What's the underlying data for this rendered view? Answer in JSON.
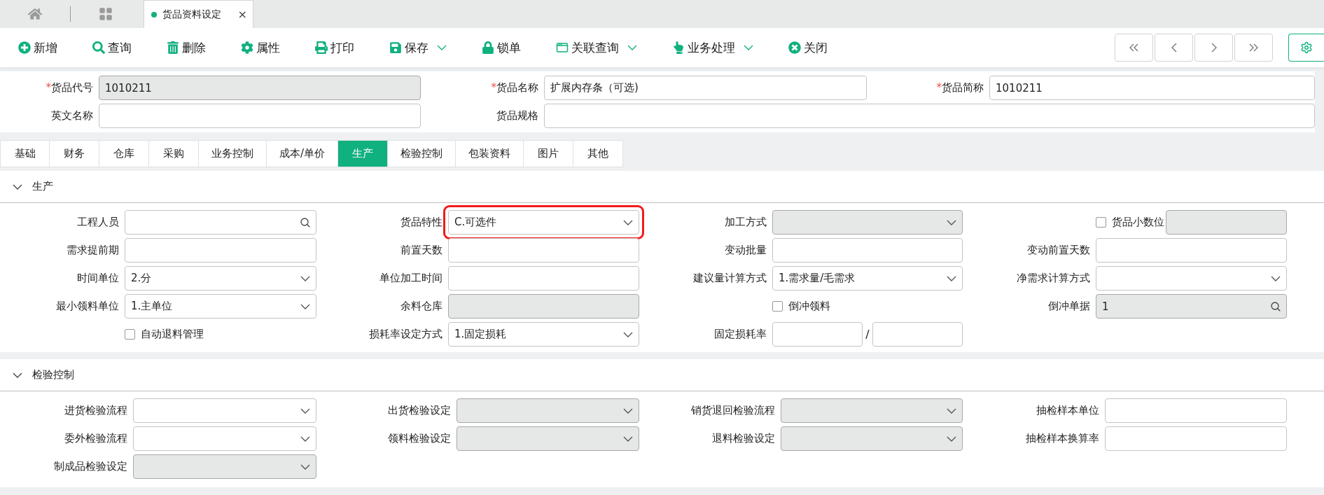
{
  "window_tabs": [
    {
      "label": "货品资料设定",
      "selected": true,
      "close": "×"
    }
  ],
  "toolbar": [
    {
      "label": "新增",
      "dropdown": false
    },
    {
      "label": "查询",
      "dropdown": false
    },
    {
      "label": "删除",
      "dropdown": false
    },
    {
      "label": "属性",
      "dropdown": false
    },
    {
      "label": "打印",
      "dropdown": false
    },
    {
      "label": "保存",
      "dropdown": true
    },
    {
      "label": "锁单",
      "dropdown": false
    },
    {
      "label": "关联查询",
      "dropdown": true
    },
    {
      "label": "业务处理",
      "dropdown": true
    },
    {
      "label": "关闭",
      "dropdown": false
    }
  ],
  "header_form": [
    [
      {
        "label": "货品代号",
        "required_mark": "*",
        "value": "1010211",
        "disabled": true
      },
      {
        "label": "货品名称",
        "required_mark": "*",
        "value": "扩展内存条（可选)",
        "disabled": false
      },
      {
        "label": "货品简称",
        "required_mark": "*",
        "value": "1010211",
        "disabled": false
      }
    ],
    [
      {
        "label": "英文名称",
        "disabled": false
      },
      {
        "label": "货品规格",
        "disabled": false,
        "wide": true
      }
    ]
  ],
  "tabs": [
    {
      "label": "基础",
      "selected": false
    },
    {
      "label": "财务",
      "selected": false
    },
    {
      "label": "仓库",
      "selected": false
    },
    {
      "label": "采购",
      "selected": false
    },
    {
      "label": "业务控制",
      "selected": false
    },
    {
      "label": "成本/单价",
      "selected": false
    },
    {
      "label": "生产",
      "selected": true
    },
    {
      "label": "检验控制",
      "selected": false
    },
    {
      "label": "包装资料",
      "selected": false
    },
    {
      "label": "图片",
      "selected": false
    },
    {
      "label": "其他",
      "selected": false
    }
  ],
  "sections": [
    {
      "title": "生产",
      "expanded": true,
      "rows": [
        [
          {
            "kind": "search",
            "label": "工程人员",
            "disabled": false
          },
          {
            "kind": "select",
            "label": "货品特性",
            "value": "C.可选件",
            "disabled": false,
            "highlighted": true
          },
          {
            "kind": "select",
            "label": "加工方式",
            "disabled": true
          },
          {
            "kind": "checkbox_input",
            "label": "货品小数位",
            "checked": false,
            "disabled": true
          }
        ],
        [
          {
            "kind": "text",
            "label": "需求提前期",
            "disabled": false
          },
          {
            "kind": "text",
            "label": "前置天数",
            "disabled": false
          },
          {
            "kind": "text",
            "label": "变动批量",
            "disabled": false
          },
          {
            "kind": "text",
            "label": "变动前置天数",
            "disabled": false
          }
        ],
        [
          {
            "kind": "select",
            "label": "时间单位",
            "value": "2.分",
            "disabled": false
          },
          {
            "kind": "text",
            "label": "单位加工时间",
            "disabled": false
          },
          {
            "kind": "select",
            "label": "建议量计算方式",
            "value": "1.需求量/毛需求",
            "disabled": false
          },
          {
            "kind": "select",
            "label": "净需求计算方式",
            "disabled": false
          }
        ],
        [
          {
            "kind": "select",
            "label": "最小领料单位",
            "value": "1.主单位",
            "disabled": false
          },
          {
            "kind": "text",
            "label": "余料仓库",
            "disabled": true
          },
          {
            "kind": "checkbox",
            "label": "倒冲领料",
            "checked": false
          },
          {
            "kind": "search",
            "label": "倒冲单据",
            "value": "1",
            "disabled": true
          }
        ],
        [
          {
            "kind": "checkbox",
            "label": "自动退料管理",
            "checked": false
          },
          {
            "kind": "select",
            "label": "损耗率设定方式",
            "value": "1.固定损耗",
            "disabled": false
          },
          {
            "kind": "ratio",
            "label": "固定损耗率",
            "separator": "/"
          },
          {
            "kind": "empty"
          }
        ]
      ]
    },
    {
      "title": "检验控制",
      "expanded": true,
      "rows": [
        [
          {
            "kind": "select",
            "label": "进货检验流程",
            "disabled": false
          },
          {
            "kind": "select",
            "label": "出货检验设定",
            "disabled": true
          },
          {
            "kind": "select",
            "label": "销货退回检验流程",
            "disabled": true
          },
          {
            "kind": "text",
            "label": "抽检样本单位",
            "disabled": false
          }
        ],
        [
          {
            "kind": "select",
            "label": "委外检验流程",
            "disabled": false
          },
          {
            "kind": "select",
            "label": "领料检验设定",
            "disabled": true
          },
          {
            "kind": "select",
            "label": "退料检验设定",
            "disabled": true
          },
          {
            "kind": "text",
            "label": "抽检样本换算率",
            "disabled": false
          }
        ],
        [
          {
            "kind": "select",
            "label": "制成品检验设定",
            "disabled": true
          },
          {
            "kind": "empty"
          },
          {
            "kind": "empty"
          },
          {
            "kind": "empty"
          }
        ]
      ]
    }
  ]
}
